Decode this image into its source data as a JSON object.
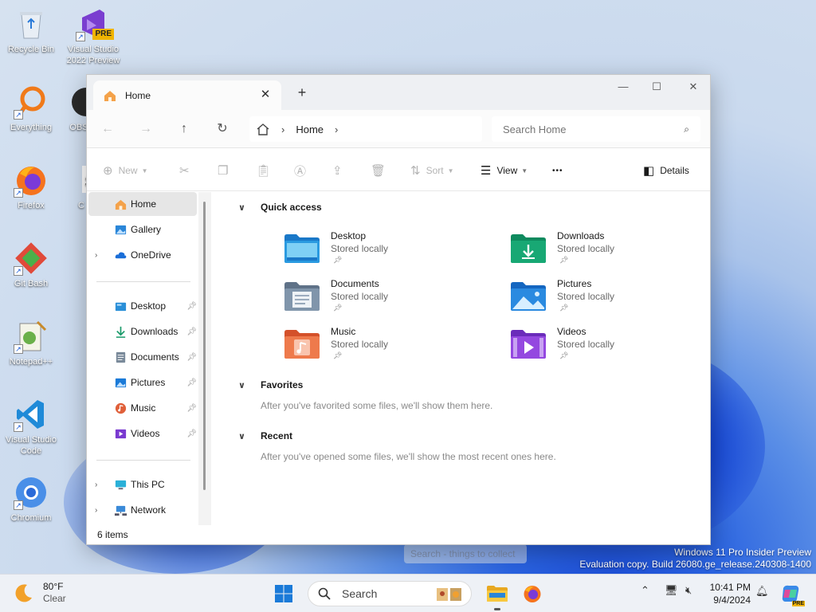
{
  "desktop": {
    "icons": [
      {
        "label": "Recycle Bin"
      },
      {
        "label": "Visual Studio 2022 Preview",
        "badge": "PRE"
      },
      {
        "label": "Everything"
      },
      {
        "label": "OBS"
      },
      {
        "label": "Firefox"
      },
      {
        "label": "C"
      },
      {
        "label": "Git Bash"
      },
      {
        "label": "Notepad++"
      },
      {
        "label": "Visual Studio Code"
      },
      {
        "label": "Chromium"
      }
    ],
    "watermark_line1": "Windows 11 Pro Insider Preview",
    "watermark_line2": "Evaluation copy. Build 26080.ge_release.240308-1400",
    "ghost_search": "Search - things to collect"
  },
  "explorer": {
    "tab_title": "Home",
    "window_controls": {
      "minimize": "—",
      "maximize": "☐",
      "close": "✕"
    },
    "breadcrumb": [
      "Home"
    ],
    "search_placeholder": "Search Home",
    "toolbar": {
      "new": "New",
      "sort": "Sort",
      "view": "View",
      "more": "•••",
      "details": "Details"
    },
    "sidebar": {
      "top": [
        {
          "label": "Home",
          "icon": "home-icon",
          "selected": true
        },
        {
          "label": "Gallery",
          "icon": "gallery-icon"
        },
        {
          "label": "OneDrive",
          "icon": "cloud-icon",
          "expandable": true
        }
      ],
      "pinned": [
        {
          "label": "Desktop",
          "icon": "desktop-folder-icon",
          "color": "#2a8fd8"
        },
        {
          "label": "Downloads",
          "icon": "download-icon",
          "color": "#1a9a6a"
        },
        {
          "label": "Documents",
          "icon": "document-icon",
          "color": "#6a7a8a"
        },
        {
          "label": "Pictures",
          "icon": "pictures-icon",
          "color": "#1a7ad8"
        },
        {
          "label": "Music",
          "icon": "music-icon",
          "color": "#e0603a"
        },
        {
          "label": "Videos",
          "icon": "videos-icon",
          "color": "#7a3ad0"
        }
      ],
      "bottom": [
        {
          "label": "This PC",
          "icon": "computer-icon"
        },
        {
          "label": "Network",
          "icon": "network-icon"
        }
      ]
    },
    "quick_access": {
      "header": "Quick access",
      "items": [
        {
          "name": "Desktop",
          "status": "Stored locally",
          "color": "#1e8fd6"
        },
        {
          "name": "Downloads",
          "status": "Stored locally",
          "color": "#16a37a"
        },
        {
          "name": "Documents",
          "status": "Stored locally",
          "color": "#7a8ea4"
        },
        {
          "name": "Pictures",
          "status": "Stored locally",
          "color": "#1f86e0"
        },
        {
          "name": "Music",
          "status": "Stored locally",
          "color": "#e8653c"
        },
        {
          "name": "Videos",
          "status": "Stored locally",
          "color": "#8a3fd6"
        }
      ]
    },
    "favorites": {
      "header": "Favorites",
      "message": "After you've favorited some files, we'll show them here."
    },
    "recent": {
      "header": "Recent",
      "message": "After you've opened some files, we'll show the most recent ones here."
    },
    "status": "6 items"
  },
  "taskbar": {
    "weather_temp": "80°F",
    "weather_desc": "Clear",
    "search_label": "Search",
    "time": "10:41 PM",
    "date": "9/4/2024"
  }
}
